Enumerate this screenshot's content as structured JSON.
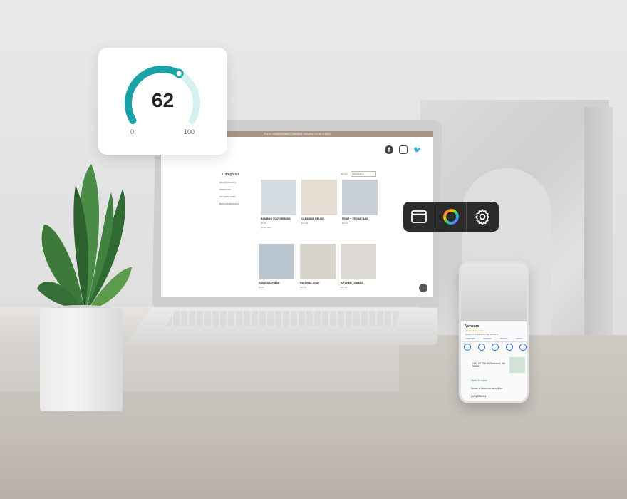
{
  "gauge": {
    "value": "62",
    "min_label": "0",
    "max_label": "100",
    "color": "#1aa3a6",
    "track_color": "#d6efef",
    "fraction": 0.62
  },
  "website": {
    "announcement": "Enjoy complimentary standard shipping on all orders",
    "categories_title": "Categories",
    "categories": [
      "ALL PRODUCTS",
      "PERSONAL",
      "KITCHEN CARE",
      "BATH ESSENTIALS"
    ],
    "sort_label": "Sort by",
    "sort_value": "Best Selling",
    "products": [
      {
        "name": "BAMBOO TOOTHBRUSH",
        "price": "$6.00",
        "note": "Quick view",
        "color": "#d6dde2"
      },
      {
        "name": "CLEANING BRUSH",
        "price": "$12.00",
        "note": "",
        "color": "#e6ddd2"
      },
      {
        "name": "FRUIT + VEGGIE BAG",
        "price": "$8.00",
        "note": "",
        "color": "#c9cfd6"
      },
      {
        "name": "HAND SOAP BAR",
        "price": "$9.00",
        "note": "",
        "color": "#b9c6cf"
      },
      {
        "name": "NATURAL SOAP",
        "price": "$10.00",
        "note": "",
        "color": "#d9d4cb"
      },
      {
        "name": "KITCHEN TOWELS",
        "price": "$14.00",
        "note": "",
        "color": "#dcd8d4"
      }
    ],
    "accent": "#a69486"
  },
  "toolbar": {
    "items": [
      "browser-window-icon",
      "color-wheel-icon",
      "gear-icon"
    ]
  },
  "phone_listing": {
    "business_name": "Vensure",
    "rating": "4.8 ★★★★★ (112)",
    "subtitle": "Range of sustainable day products",
    "tabs": [
      "OVERVIEW",
      "REVIEWS",
      "PHOTOS",
      "ABOUT"
    ],
    "address": "1115 NE 200 St Redmond, WA 98053",
    "hours": "Open 24 hours",
    "service": "Serves a Vancouver area office",
    "phone": "(425) 555-0161"
  }
}
